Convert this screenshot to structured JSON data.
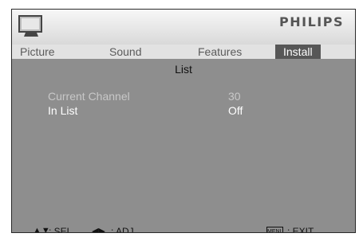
{
  "header": {
    "brand": "PHILIPS",
    "icon": "tv-icon"
  },
  "tabs": [
    {
      "label": "Picture",
      "active": false
    },
    {
      "label": "Sound",
      "active": false
    },
    {
      "label": "Features",
      "active": false
    },
    {
      "label": "Install",
      "active": true
    }
  ],
  "section": {
    "title": "List"
  },
  "settings": [
    {
      "label": "Current Channel",
      "value": "30"
    },
    {
      "label": "In List",
      "value": "Off"
    }
  ],
  "footer": {
    "sel_glyph": "▲▼",
    "sel_text": ": SEL",
    "adj_glyph": "◀▶",
    "adj_text": ": ADJ",
    "menu_key": "MENU",
    "exit_text": ": EXIT"
  }
}
